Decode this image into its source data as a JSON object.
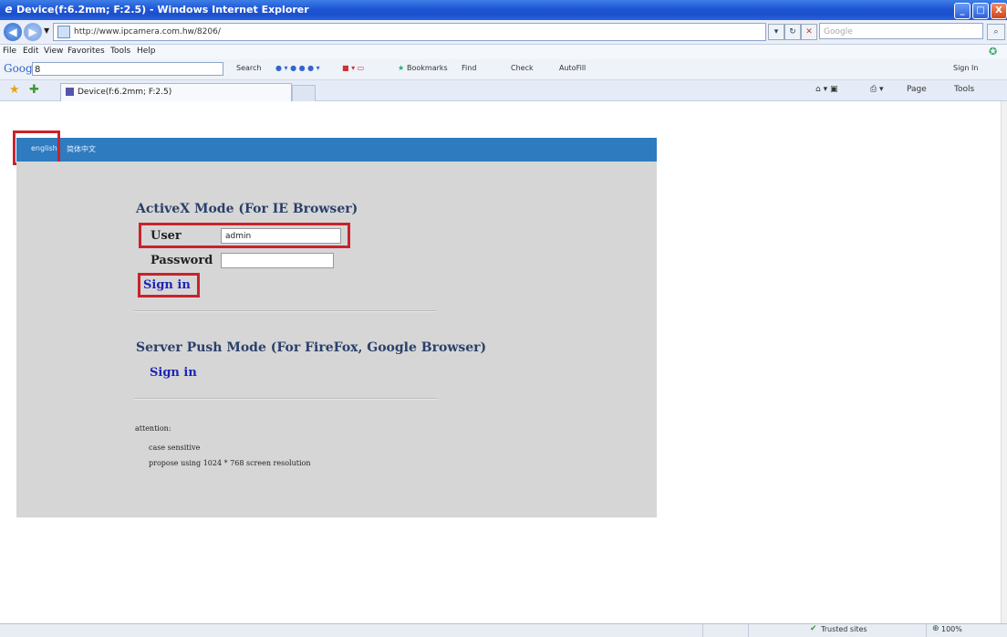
{
  "window": {
    "title": "Device(f:6.2mm; F:2.5) - Windows Internet Explorer",
    "controls": {
      "minimize": "_",
      "maximize": "□",
      "close": "X"
    }
  },
  "nav": {
    "address": "http://www.ipcamera.com.hw/8206/",
    "search_placeholder": "Google"
  },
  "menu": [
    "File",
    "Edit",
    "View",
    "Favorites",
    "Tools",
    "Help"
  ],
  "google_toolbar": {
    "logo": "Google",
    "search_value": "8",
    "items": [
      "Search",
      "Bookmarks",
      "Find",
      "Check",
      "AutoFill"
    ],
    "signin": "Sign In"
  },
  "tab": {
    "title": "Device(f:6.2mm; F:2.5)",
    "commands": [
      "Page",
      "Tools"
    ]
  },
  "page": {
    "lang_en": "english",
    "lang_cn": "简体中文",
    "activex_title": "ActiveX Mode (For IE Browser)",
    "user_label": "User",
    "user_value": "admin",
    "password_label": "Password",
    "signin_label": "Sign in",
    "server_push_title": "Server Push Mode (For FireFox, Google Browser)",
    "signin2_label": "Sign in",
    "attention_label": "attention:",
    "note1": "case sensitive",
    "note2": "propose using 1024 * 768 screen resolution"
  },
  "status": {
    "zone": "Trusted sites",
    "zoom": "100%"
  },
  "colors": {
    "lang_bar": "#2e7bbf",
    "panel": "#d6d6d6",
    "highlight": "#c8232c",
    "link": "#1f24b8"
  }
}
